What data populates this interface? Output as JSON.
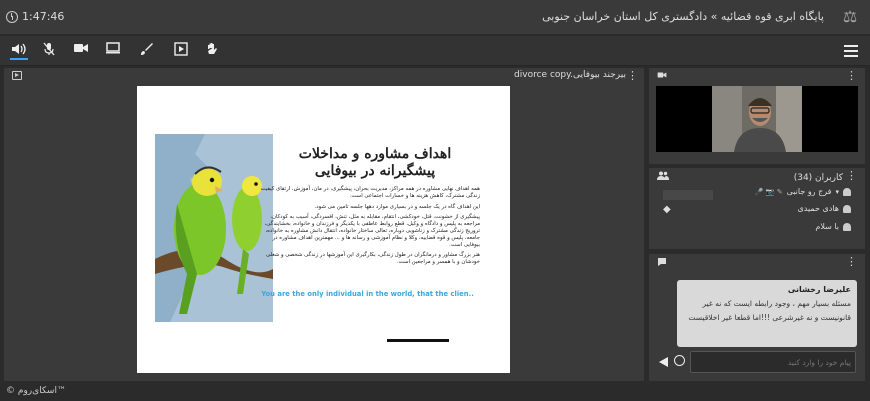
{
  "header": {
    "timer": "1:47:46",
    "title": "پایگاه ابری قوه قضائیه » دادگستری کل استان خراسان جنوبی"
  },
  "toolbar": {
    "icons": [
      "speaker-icon",
      "mic-muted-icon",
      "camera-icon",
      "screen-share-icon",
      "brush-icon",
      "play-icon",
      "raise-hand-icon"
    ]
  },
  "presentation": {
    "file_title": "divorce copy.بیرجند بیوفایی",
    "slide": {
      "heading": "اهداف مشاوره و مداخلات پیشگیرانه در بیوفایی",
      "bullets": [
        "همه اهداف نهایی مشاوره در همه مراکز، مدیریت بحران، پیشگیری، در مان، آموزش، ارتقای کیفیت زندگی مشترک، کاهش هزینه ها و خسارات اجتماعی است.",
        "این اهداف گاه در یک جلسه و در بسیاری موارد دهها جلسه تامین می شود.",
        "پیشگیری از خشونت، قتل، خودکشی، انتقام، مقابله به مثل، تنش، افسردگی، آسیب به کودکان، مراجعه به پلیس و دادگاه و وکیل، قطع روابط عاطفی با یکدیگر و فرزندان و خانواده، بخشایندگی، تروریج زندگی مشترک و زناشویی دوباره، تعالی ساختار خانواده، انتقال دانش مشاوره به خانواده، جامعه، پلیس و قوه قضاییه، وکلا و نظام آموزشی و رسانه ها و ... مهمترین اهداف مشاوره در بیوفایی است.",
        "هنر بزرگ مشاور و درمانگران در طول زندگی، بکارگیری این آموزشها در زندگی شخصی و شغلی خودشان و با همسر و مراجعین است."
      ],
      "quote": "You are the only individual in the world, that the clien.."
    }
  },
  "users_panel": {
    "title": "کاربران (34)",
    "users": [
      "فرج رو جانبی",
      "هادی حمیدی",
      "با سلام"
    ]
  },
  "chat_panel": {
    "message": {
      "sender": "علیرضا رخشانی",
      "text": "مسئله بسیار مهم ، وجود رابطه ایست که نه غیر قانونیست و نه غیرشرعی !!!اما قطعا غیر اخلاقیست"
    },
    "input_placeholder": "پیام خود را وارد کنید"
  },
  "footer": {
    "brand": "© اسکای‌روم™"
  },
  "colors": {
    "accent": "#3fa0f0",
    "slide_quote": "#3aa6e0"
  }
}
